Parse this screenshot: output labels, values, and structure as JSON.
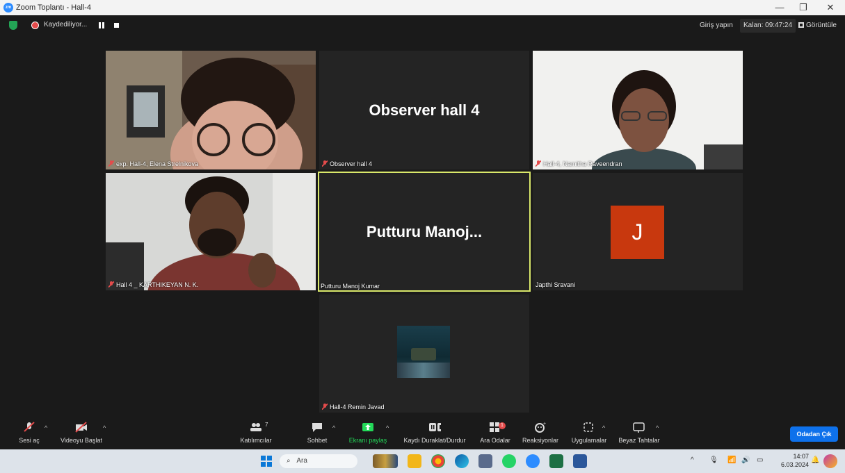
{
  "window": {
    "title": "Zoom Toplantı - Hall-4"
  },
  "topbar": {
    "recording_label": "Kaydediliyor...",
    "signin_label": "Giriş yapın",
    "timer_label": "Kalan: 09:47:24",
    "view_label": "Görüntüle"
  },
  "tiles": [
    {
      "name": "exp. Hall-4, Elena Strelnikova",
      "muted": true,
      "type": "video"
    },
    {
      "name": "Observer hall 4",
      "display": "Observer hall 4",
      "muted": true,
      "type": "name"
    },
    {
      "name": "Hall-4, Namitha Raveendran",
      "muted": true,
      "type": "video"
    },
    {
      "name": "Hall 4 _ KARTHIKEYAN N. K.",
      "muted": true,
      "type": "video"
    },
    {
      "name": "Putturu Manoj Kumar",
      "display": "Putturu  Manoj...",
      "muted": false,
      "type": "name",
      "active": true
    },
    {
      "name": "Japthi Sravani",
      "avatar_letter": "J",
      "muted": false,
      "type": "avatar"
    },
    {
      "name": "Hall-4 Remin Javad",
      "muted": true,
      "type": "picture"
    }
  ],
  "toolbar": {
    "audio": "Sesi aç",
    "video": "Videoyu Başlat",
    "participants": "Katılımcılar",
    "participants_count": "7",
    "chat": "Sohbet",
    "share": "Ekranı paylaş",
    "record": "Kaydı Duraklat/Durdur",
    "breakout": "Ara Odalar",
    "breakout_badge": "1",
    "reactions": "Reaksiyonlar",
    "apps": "Uygulamalar",
    "whiteboard": "Beyaz Tahtalar",
    "leave": "Odadan Çık"
  },
  "taskbar": {
    "search_placeholder": "Ara",
    "time": "14:07",
    "date": "6.03.2024"
  },
  "colors": {
    "accent": "#0e71eb",
    "share_green": "#23d959",
    "active_border": "#d9e86a",
    "avatar_bg": "#c8380e",
    "muted_red": "#e44b4b"
  }
}
